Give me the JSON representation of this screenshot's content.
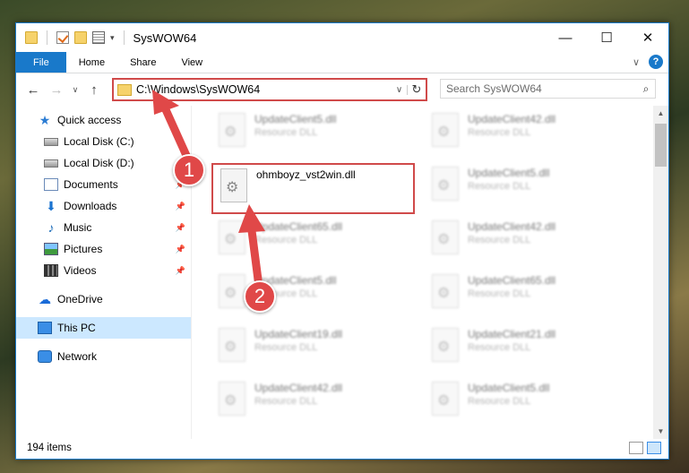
{
  "window": {
    "title": "SysWOW64",
    "controls": {
      "minimize": "—",
      "maximize": "☐",
      "close": "✕"
    }
  },
  "ribbon": {
    "tabs": [
      {
        "label": "File"
      },
      {
        "label": "Home"
      },
      {
        "label": "Share"
      },
      {
        "label": "View"
      }
    ],
    "help": "?",
    "expand_glyph": "∨"
  },
  "nav": {
    "back": "←",
    "forward": "→",
    "recent": "∨",
    "up": "↑",
    "address": "C:\\Windows\\SysWOW64",
    "address_dropdown": "∨",
    "refresh": "↻",
    "search_placeholder": "Search SysWOW64",
    "search_icon": "⌕"
  },
  "sidebar": {
    "items": [
      {
        "label": "Quick access",
        "icon": "star-icon"
      },
      {
        "label": "Local Disk (C:)",
        "icon": "disk-icon"
      },
      {
        "label": "Local Disk (D:)",
        "icon": "disk-icon"
      },
      {
        "label": "Documents",
        "icon": "documents-icon",
        "pinned": true
      },
      {
        "label": "Downloads",
        "icon": "downloads-icon",
        "pinned": true
      },
      {
        "label": "Music",
        "icon": "music-icon",
        "pinned": true
      },
      {
        "label": "Pictures",
        "icon": "pictures-icon",
        "pinned": true
      },
      {
        "label": "Videos",
        "icon": "videos-icon",
        "pinned": true
      },
      {
        "label": "OneDrive",
        "icon": "onedrive-icon"
      },
      {
        "label": "This PC",
        "icon": "this-pc-icon",
        "selected": true
      },
      {
        "label": "Network",
        "icon": "network-icon"
      }
    ],
    "pin_glyph": "📌"
  },
  "files": {
    "items": [
      {
        "name": "UpdateClient5.dll",
        "desc": "Resource DLL",
        "blurred": true
      },
      {
        "name": "UpdateClient42.dll",
        "desc": "Resource DLL",
        "blurred": true
      },
      {
        "name": "ohmboyz_vst2win.dll",
        "desc": "",
        "blurred": false,
        "highlighted": true
      },
      {
        "name": "UpdateClient5.dll",
        "desc": "Resource DLL",
        "blurred": true
      },
      {
        "name": "UpdateClient65.dll",
        "desc": "Resource DLL",
        "blurred": true
      },
      {
        "name": "UpdateClient42.dll",
        "desc": "Resource DLL",
        "blurred": true
      },
      {
        "name": "UpdateClient5.dll",
        "desc": "Resource DLL",
        "blurred": true
      },
      {
        "name": "UpdateClient65.dll",
        "desc": "Resource DLL",
        "blurred": true
      },
      {
        "name": "UpdateClient19.dll",
        "desc": "Resource DLL",
        "blurred": true
      },
      {
        "name": "UpdateClient21.dll",
        "desc": "Resource DLL",
        "blurred": true
      },
      {
        "name": "UpdateClient42.dll",
        "desc": "Resource DLL",
        "blurred": true
      },
      {
        "name": "UpdateClient5.dll",
        "desc": "Resource DLL",
        "blurred": true
      }
    ]
  },
  "status": {
    "count": "194 items"
  },
  "annotations": {
    "step1": "1",
    "step2": "2",
    "color": "#e04848"
  }
}
